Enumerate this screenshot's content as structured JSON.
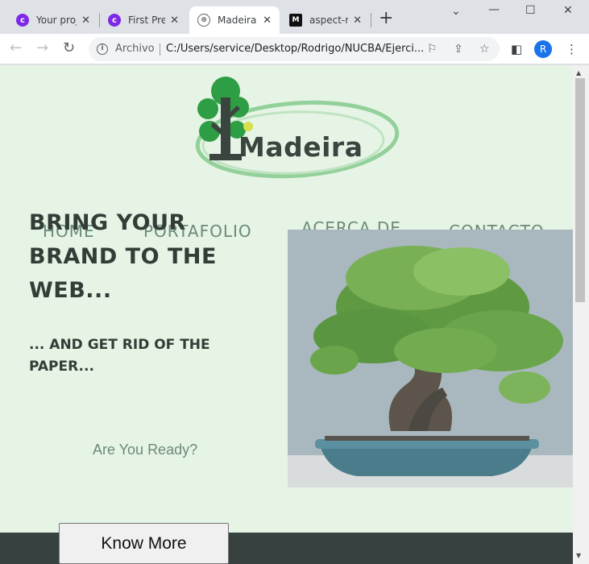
{
  "browser": {
    "tabs": [
      {
        "title": "Your proj",
        "favicon": "c-icon"
      },
      {
        "title": "First Pres",
        "favicon": "c-icon"
      },
      {
        "title": "Madeira",
        "favicon": "globe-icon",
        "active": true
      },
      {
        "title": "aspect-ra",
        "favicon": "m-icon"
      }
    ],
    "address": {
      "scheme_label": "Archivo",
      "url": "C:/Users/service/Desktop/Rodrigo/NUCBA/Ejerci..."
    },
    "profile_initial": "R"
  },
  "page": {
    "logo_text": "Madeira",
    "nav": [
      "HOME",
      "PORTAFOLIO",
      "ACERCA DE",
      "CONTACTO"
    ],
    "hero_title": "BRING YOUR BRAND TO THE WEB...",
    "hero_subtitle": "... AND GET RID OF THE PAPER...",
    "cta_prompt": "Are You Ready?",
    "cta_button": "Know More"
  },
  "colors": {
    "page_background": "#e6f4e5",
    "logo_green": "#2e9e44",
    "heading": "#333d38",
    "muted_green": "#6b8a78",
    "footer": "#364140"
  }
}
